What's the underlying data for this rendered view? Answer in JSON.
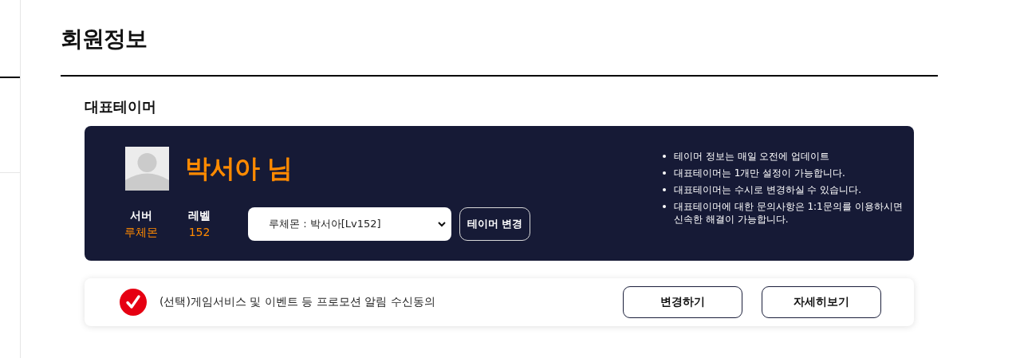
{
  "page_title": "회원정보",
  "section_title": "대표테이머",
  "tamer": {
    "name": "박서아 님",
    "stats": [
      {
        "label": "서버",
        "value": "루체몬"
      },
      {
        "label": "레벨",
        "value": "152"
      }
    ],
    "select_value": "루체몬 : 박서아[Lv152]",
    "change_button": "테이머 변경",
    "notes": [
      "테이머 정보는 매일 오전에 업데이트",
      "대표테이머는 1개만 설정이 가능합니다.",
      "대표테이머는 수시로 변경하실 수 있습니다.",
      "대표테이머에 대한 문의사항은 1:1문의를 이용하시면 신속한 해결이 가능합니다."
    ]
  },
  "consent": {
    "checked": true,
    "label": "(선택)게임서비스 및 이벤트 등 프로모션 알림 수신동의",
    "buttons": [
      "변경하기",
      "자세히보기"
    ]
  }
}
